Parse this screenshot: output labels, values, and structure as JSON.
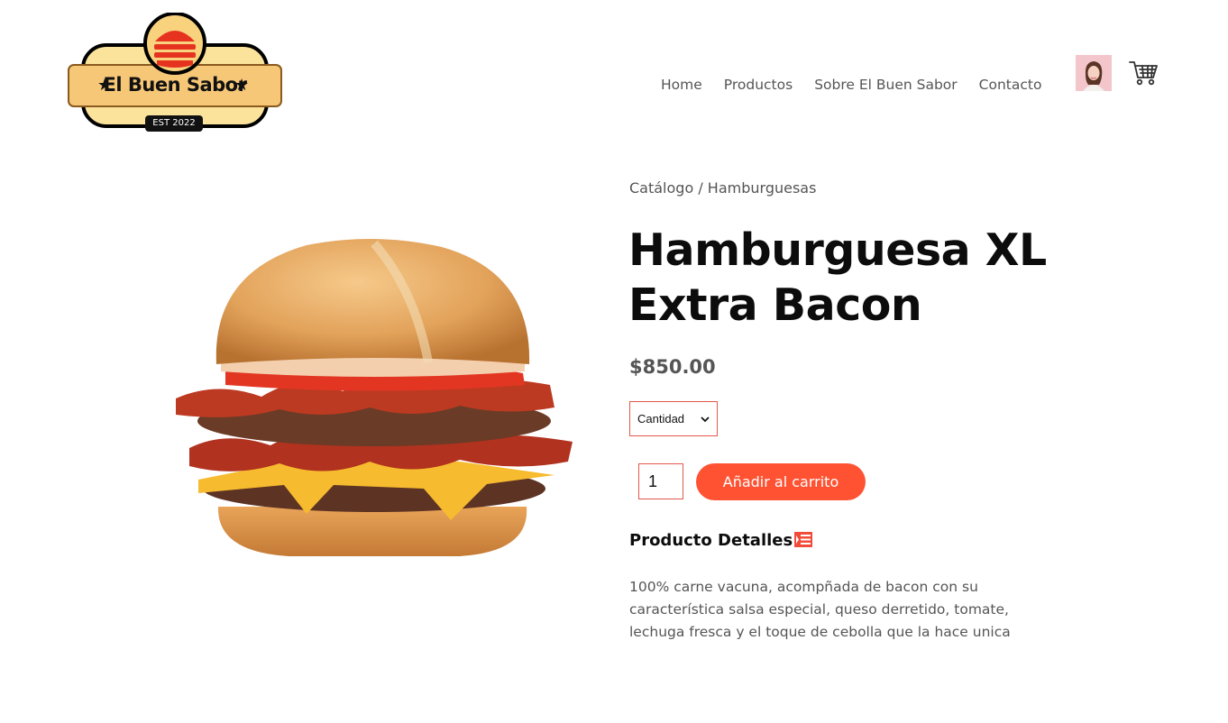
{
  "brand": {
    "name": "El Buen Sabor",
    "est": "EST 2022",
    "colors": {
      "badge_fill": "#f9d27e",
      "badge_border": "#000000",
      "burger_red": "#e63320"
    }
  },
  "nav": {
    "items": [
      "Home",
      "Productos",
      "Sobre El Buen Sabor",
      "Contacto"
    ],
    "avatar_icon": "user-avatar",
    "cart_icon": "shopping-cart-icon"
  },
  "breadcrumb": {
    "catalog": "Catálogo",
    "separator": " / ",
    "category": "Hamburguesas"
  },
  "product": {
    "title": "Hamburguesa XL Extra Bacon",
    "price": "$850.00",
    "quantity_select_label": "Cantidad",
    "quantity_value": "1",
    "add_to_cart_label": "Añadir al carrito",
    "details_title": "Producto Detalles",
    "details_icon": "list-details-icon",
    "description": "100% carne vacuna, acompñada de bacon con su característica salsa especial, queso derretido, tomate, lechuga fresca y el toque de cebolla que la hace unica",
    "image_icon": "burger-photo"
  },
  "colors": {
    "accent": "#ff5233",
    "title": "#0c0c0c",
    "text": "#555555"
  }
}
